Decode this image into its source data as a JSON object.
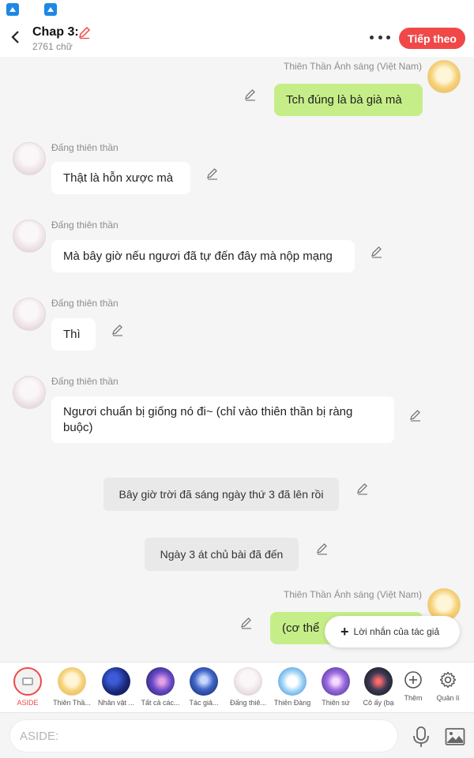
{
  "header": {
    "title": "Chap 3:",
    "word_count": "2761 chữ",
    "next_label": "Tiếp theo"
  },
  "messages": [
    {
      "side": "right",
      "sender": "Thiên Thần Ánh sáng (Việt Nam)",
      "text": "Tch đúng là bà già mà",
      "style": "green"
    },
    {
      "side": "left",
      "sender": "Đấng thiên thần",
      "text": "Thật là hỗn xược mà",
      "style": "white"
    },
    {
      "side": "left",
      "sender": "Đấng thiên thần",
      "text": "Mà bây giờ nếu ngươi đã tự đến đây mà nộp mạng",
      "style": "white"
    },
    {
      "side": "left",
      "sender": "Đấng thiên thần",
      "text": "Thì",
      "style": "white"
    },
    {
      "side": "left",
      "sender": "Đấng thiên thần",
      "text": "Ngươi chuẩn bị giống nó đi~ (chỉ vào thiên thần bị ràng buộc)",
      "style": "white"
    },
    {
      "side": "center",
      "text": "Bây giờ trời đã sáng ngày thứ 3 đã lên rồi",
      "style": "gray"
    },
    {
      "side": "center",
      "text": "Ngày 3 át chủ bài đã đến",
      "style": "gray"
    },
    {
      "side": "right",
      "sender": "Thiên Thần Ánh sáng (Việt Nam)",
      "text": "(cơ thể",
      "style": "green"
    }
  ],
  "fab": {
    "label": "Lời nhắn của tác giả"
  },
  "characters": [
    {
      "label": "ASIDE",
      "active": true
    },
    {
      "label": "Thiên Thầ..."
    },
    {
      "label": "Nhân vật ..."
    },
    {
      "label": "Tất cả các..."
    },
    {
      "label": "Tác giả..."
    },
    {
      "label": "Đấng thiê..."
    },
    {
      "label": "Thiên Đàng"
    },
    {
      "label": "Thiên sứ"
    },
    {
      "label": "Cô ấy (bạ"
    },
    {
      "label": "Thêm"
    },
    {
      "label": "Quản lí"
    }
  ],
  "input": {
    "placeholder": "ASIDE:"
  },
  "colors": {
    "accent": "#f04848",
    "green_bubble": "#c6ee88",
    "bg": "#f5f5f5"
  }
}
